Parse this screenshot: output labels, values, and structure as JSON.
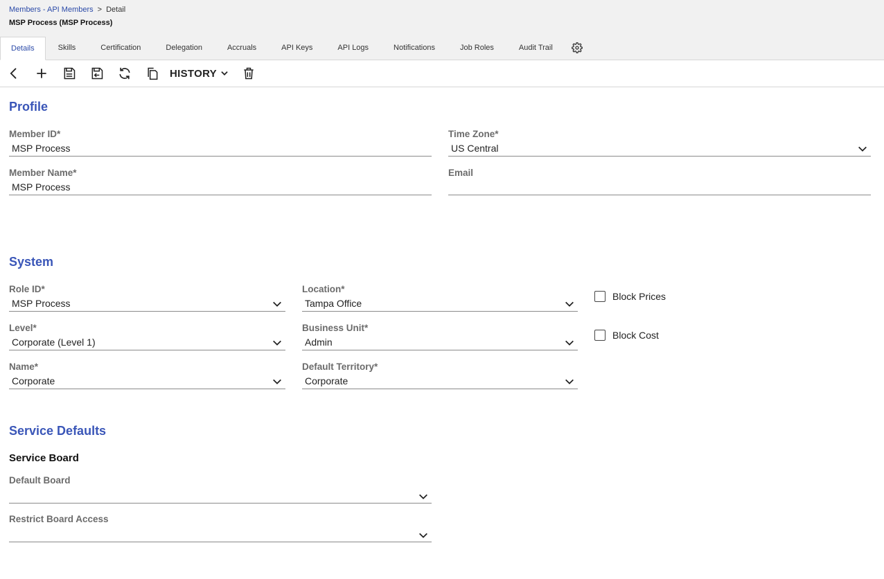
{
  "breadcrumb": {
    "parent": "Members - API Members",
    "separator": ">",
    "current": "Detail"
  },
  "page_title": "MSP Process (MSP Process)",
  "tabs": [
    {
      "label": "Details",
      "active": true
    },
    {
      "label": "Skills"
    },
    {
      "label": "Certification"
    },
    {
      "label": "Delegation"
    },
    {
      "label": "Accruals"
    },
    {
      "label": "API Keys"
    },
    {
      "label": "API Logs"
    },
    {
      "label": "Notifications"
    },
    {
      "label": "Job Roles"
    },
    {
      "label": "Audit Trail"
    }
  ],
  "toolbar": {
    "history_label": "HISTORY"
  },
  "profile": {
    "title": "Profile",
    "member_id": {
      "label": "Member ID*",
      "value": "MSP Process"
    },
    "time_zone": {
      "label": "Time Zone*",
      "value": "US Central"
    },
    "member_name": {
      "label": "Member Name*",
      "value": "MSP Process"
    },
    "email": {
      "label": "Email",
      "value": ""
    }
  },
  "system": {
    "title": "System",
    "role_id": {
      "label": "Role ID*",
      "value": "MSP Process"
    },
    "location": {
      "label": "Location*",
      "value": "Tampa Office"
    },
    "level": {
      "label": "Level*",
      "value": "Corporate (Level 1)"
    },
    "business_unit": {
      "label": "Business Unit*",
      "value": "Admin"
    },
    "name": {
      "label": "Name*",
      "value": "Corporate"
    },
    "default_territory": {
      "label": "Default Territory*",
      "value": "Corporate"
    },
    "block_prices": {
      "label": "Block Prices",
      "checked": false
    },
    "block_cost": {
      "label": "Block Cost",
      "checked": false
    }
  },
  "service_defaults": {
    "title": "Service Defaults",
    "subtitle": "Service Board",
    "default_board": {
      "label": "Default Board",
      "value": ""
    },
    "restrict_board_access": {
      "label": "Restrict Board Access",
      "value": ""
    }
  },
  "colors": {
    "accent": "#3a56b8",
    "link": "#2b4aa8"
  }
}
